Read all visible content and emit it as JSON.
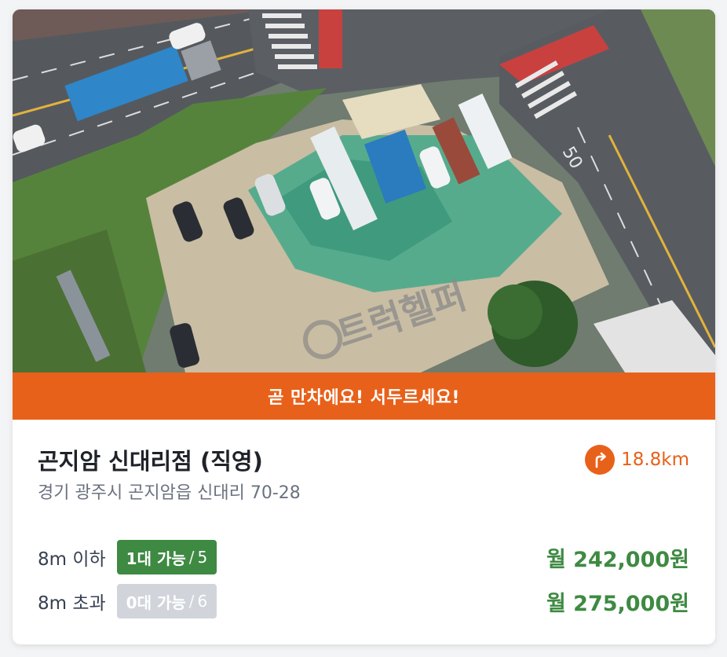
{
  "listing": {
    "banner": "곧 만차에요! 서두르세요!",
    "title": "곤지암 신대리점 (직영)",
    "address": "경기 광주시 곤지암읍 신대리 70-28",
    "distance": "18.8km",
    "watermark": "트럭헬퍼",
    "road_marking": "50",
    "image_icon": "aerial-parking-lot-photo",
    "distance_icon": "turn-right-direction-icon"
  },
  "spaces": [
    {
      "size_label": "8m 이하",
      "available": "1대 가능",
      "separator": "/",
      "total": "5",
      "price": "월 242,000원",
      "status_color": "#3e8a42"
    },
    {
      "size_label": "8m 초과",
      "available": "0대 가능",
      "separator": "/",
      "total": "6",
      "price": "월 275,000원",
      "status_color": "#d1d5db"
    }
  ],
  "colors": {
    "accent": "#e8611a",
    "price": "#3e8a42",
    "title": "#1f2329",
    "muted": "#6b7280"
  }
}
